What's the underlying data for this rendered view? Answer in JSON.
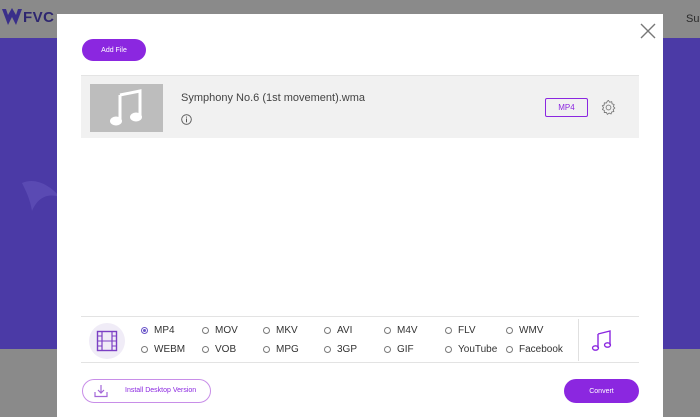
{
  "background": {
    "logo_text": "FVC",
    "nav_partial": "Sup"
  },
  "dialog": {
    "close_icon": "close-icon",
    "add_file_label": "Add File",
    "file": {
      "name": "Symphony No.6 (1st movement).wma",
      "thumbnail_icon": "music-note-icon",
      "info_icon": "info-icon",
      "output_format": "MP4",
      "settings_icon": "gear-icon"
    },
    "formats": {
      "row1": [
        "MP4",
        "MOV",
        "MKV",
        "AVI",
        "M4V",
        "FLV",
        "WMV"
      ],
      "row2": [
        "WEBM",
        "VOB",
        "MPG",
        "3GP",
        "GIF",
        "YouTube",
        "Facebook"
      ],
      "selected": "MP4",
      "video_icon": "film-icon",
      "audio_icon": "music-note-icon"
    },
    "install_label": "Install Desktop Version",
    "convert_label": "Convert"
  },
  "colors": {
    "accent": "#8b27e0",
    "radio_selected": "#6a55c9",
    "background_purple": "#4b3aa6"
  }
}
